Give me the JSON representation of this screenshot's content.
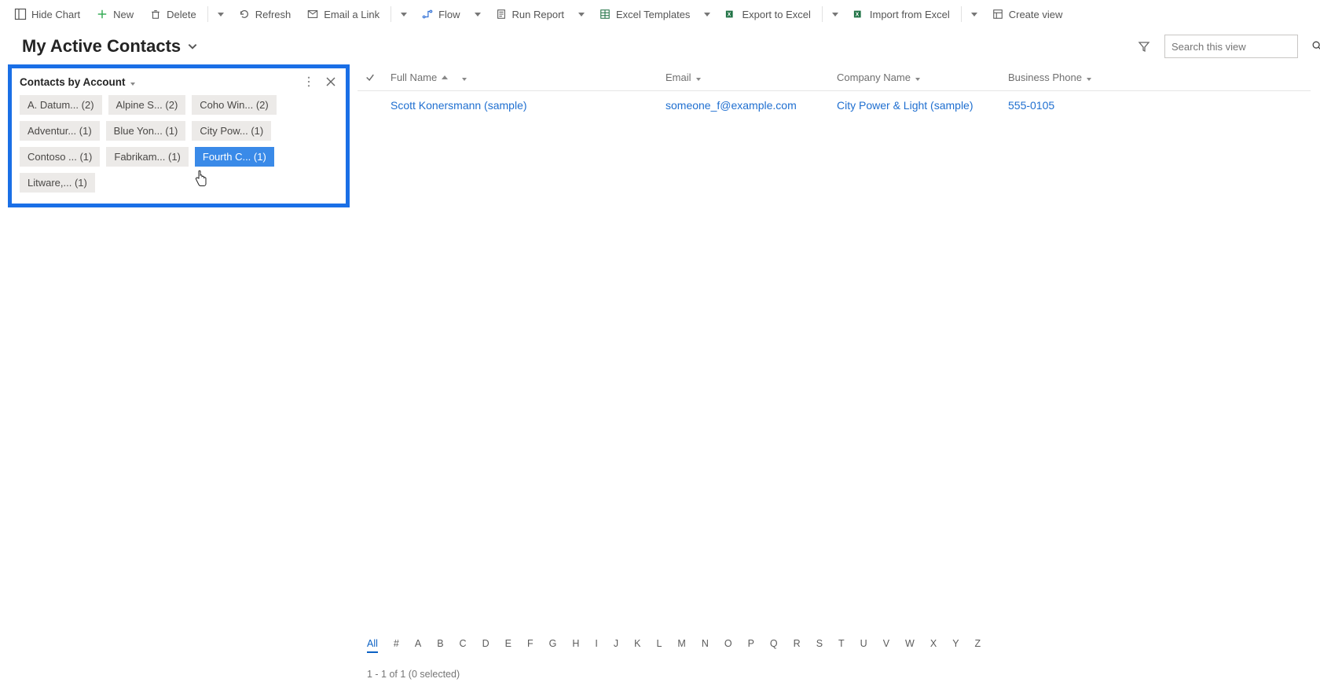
{
  "commands": {
    "hide_chart": "Hide Chart",
    "new": "New",
    "delete": "Delete",
    "refresh": "Refresh",
    "email_link": "Email a Link",
    "flow": "Flow",
    "run_report": "Run Report",
    "excel_templates": "Excel Templates",
    "export_excel": "Export to Excel",
    "import_excel": "Import from Excel",
    "create_view": "Create view"
  },
  "view": {
    "title": "My Active Contacts"
  },
  "search": {
    "placeholder": "Search this view"
  },
  "chart": {
    "title": "Contacts by Account",
    "tags": [
      {
        "label": "A. Datum... (2)",
        "selected": false
      },
      {
        "label": "Alpine S... (2)",
        "selected": false
      },
      {
        "label": "Coho Win... (2)",
        "selected": false
      },
      {
        "label": "Adventur... (1)",
        "selected": false
      },
      {
        "label": "Blue Yon... (1)",
        "selected": false
      },
      {
        "label": "City Pow... (1)",
        "selected": false
      },
      {
        "label": "Contoso ... (1)",
        "selected": false
      },
      {
        "label": "Fabrikam... (1)",
        "selected": false
      },
      {
        "label": "Fourth C... (1)",
        "selected": true
      },
      {
        "label": "Litware,... (1)",
        "selected": false
      }
    ]
  },
  "grid": {
    "columns": {
      "full_name": "Full Name",
      "email": "Email",
      "company": "Company Name",
      "phone": "Business Phone"
    },
    "rows": [
      {
        "full_name": "Scott Konersmann (sample)",
        "email": "someone_f@example.com",
        "company": "City Power & Light (sample)",
        "phone": "555-0105"
      }
    ]
  },
  "index": [
    "All",
    "#",
    "A",
    "B",
    "C",
    "D",
    "E",
    "F",
    "G",
    "H",
    "I",
    "J",
    "K",
    "L",
    "M",
    "N",
    "O",
    "P",
    "Q",
    "R",
    "S",
    "T",
    "U",
    "V",
    "W",
    "X",
    "Y",
    "Z"
  ],
  "index_active": "All",
  "status": "1 - 1 of 1 (0 selected)"
}
